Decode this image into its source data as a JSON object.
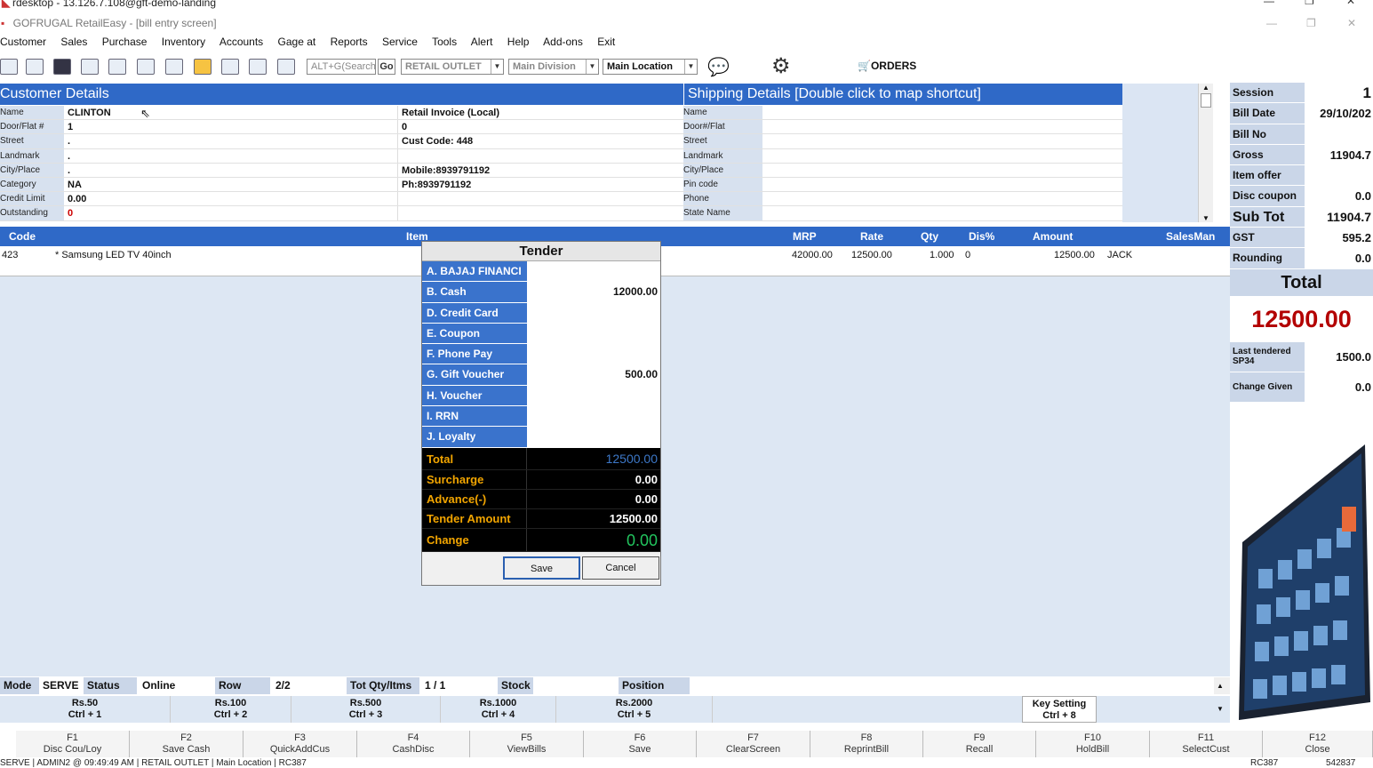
{
  "window": {
    "rd_title": "rdesktop - 13.126.7.108@gft-demo-landing",
    "app_title": "GOFRUGAL RetailEasy - [bill entry screen]"
  },
  "menu": [
    "Customer",
    "Sales",
    "Purchase",
    "Inventory",
    "Accounts",
    "Gage at",
    "Reports",
    "Service",
    "Tools",
    "Alert",
    "Help",
    "Add-ons",
    "Exit"
  ],
  "toolbar": {
    "search_placeholder": "ALT+G(Search",
    "go": "Go",
    "outlet": "RETAIL OUTLET",
    "division": "Main Division",
    "location": "Main Location",
    "orders": "ORDERS"
  },
  "customer": {
    "title": "Customer Details",
    "rows": [
      {
        "label": "Name",
        "v1": "CLINTON",
        "v2": "Retail Invoice (Local)"
      },
      {
        "label": "Door/Flat #",
        "v1": "1",
        "v2": "0"
      },
      {
        "label": "Street",
        "v1": ".",
        "v2": "Cust Code: 448"
      },
      {
        "label": "Landmark",
        "v1": ".",
        "v2": ""
      },
      {
        "label": "City/Place",
        "v1": ".",
        "v2": "Mobile:8939791192"
      },
      {
        "label": "Category",
        "v1": "NA",
        "v2": "Ph:8939791192"
      },
      {
        "label": "Credit Limit",
        "v1": "0.00",
        "v2": ""
      },
      {
        "label": "Outstanding",
        "v1": "0",
        "v2": ""
      }
    ]
  },
  "shipping": {
    "title": "Shipping Details  [Double click to map shortcut]",
    "labels": [
      "Name",
      "Door#/Flat",
      "Street",
      "Landmark",
      "City/Place",
      "Pin code",
      "Phone",
      "State Name"
    ]
  },
  "summary": {
    "rows": [
      {
        "k": "Session",
        "v": "1"
      },
      {
        "k": "Bill Date",
        "v": "29/10/202"
      },
      {
        "k": "Bill No",
        "v": ""
      },
      {
        "k": "Gross",
        "v": "11904.7"
      },
      {
        "k": "Item offer",
        "v": ""
      },
      {
        "k": "Disc coupon",
        "v": "0.0"
      },
      {
        "k": "Sub Tot",
        "v": "11904.7"
      },
      {
        "k": "GST",
        "v": "595.2"
      },
      {
        "k": "Rounding",
        "v": "0.0"
      }
    ],
    "total_label": "Total",
    "total_value": "12500.00",
    "last_tendered_label": "Last tendered SP34",
    "last_tendered_value": "1500.0",
    "change_given_label": "Change Given",
    "change_given_value": "0.0"
  },
  "grid": {
    "headers": [
      "Code",
      "Item",
      "MRP",
      "Rate",
      "Qty",
      "Dis%",
      "Amount",
      "SalesMan"
    ],
    "row": {
      "code": "423",
      "item": "* Samsung LED TV 40inch",
      "mrp": "42000.00",
      "rate": "12500.00",
      "qty": "1.000",
      "dis": "0",
      "amount": "12500.00",
      "salesman": "JACK"
    }
  },
  "tender": {
    "title": "Tender",
    "rows": [
      {
        "k": "A. BAJAJ FINANCI",
        "v": ""
      },
      {
        "k": "B. Cash",
        "v": "12000.00"
      },
      {
        "k": "D. Credit Card",
        "v": ""
      },
      {
        "k": "E. Coupon",
        "v": ""
      },
      {
        "k": "F. Phone Pay",
        "v": ""
      },
      {
        "k": "G. Gift Voucher",
        "v": "500.00"
      },
      {
        "k": "H. Voucher",
        "v": ""
      },
      {
        "k": "I. RRN",
        "v": ""
      },
      {
        "k": "J. Loyalty",
        "v": ""
      }
    ],
    "totals": [
      {
        "k": "Total",
        "v": "12500.00"
      },
      {
        "k": "Surcharge",
        "v": "0.00"
      },
      {
        "k": "Advance(-)",
        "v": "0.00"
      },
      {
        "k": "Tender Amount",
        "v": "12500.00"
      },
      {
        "k": "Change",
        "v": "0.00"
      }
    ],
    "save": "Save",
    "cancel": "Cancel"
  },
  "status": {
    "mode_label": "Mode",
    "mode": "SERVE",
    "status_label": "Status",
    "status": "Online",
    "row_label": "Row",
    "row": "2/2",
    "totqty_label": "Tot Qty/Itms",
    "totqty": "1 / 1",
    "stock_label": "Stock",
    "position_label": "Position"
  },
  "denoms": [
    {
      "l1": "Rs.50",
      "l2": "Ctrl + 1"
    },
    {
      "l1": "Rs.100",
      "l2": "Ctrl + 2"
    },
    {
      "l1": "Rs.500",
      "l2": "Ctrl + 3"
    },
    {
      "l1": "Rs.1000",
      "l2": "Ctrl + 4"
    },
    {
      "l1": "Rs.2000",
      "l2": "Ctrl + 5"
    },
    {
      "l1": "Key Setting",
      "l2": "Ctrl + 8"
    }
  ],
  "fkeys": [
    {
      "k": "F1",
      "l": "Disc Cou/Loy"
    },
    {
      "k": "F2",
      "l": "Save Cash"
    },
    {
      "k": "F3",
      "l": "QuickAddCus"
    },
    {
      "k": "F4",
      "l": "CashDisc"
    },
    {
      "k": "F5",
      "l": "ViewBills"
    },
    {
      "k": "F6",
      "l": "Save"
    },
    {
      "k": "F7",
      "l": "ClearScreen"
    },
    {
      "k": "F8",
      "l": "ReprintBill"
    },
    {
      "k": "F9",
      "l": "Recall"
    },
    {
      "k": "F10",
      "l": "HoldBill"
    },
    {
      "k": "F11",
      "l": "SelectCust"
    },
    {
      "k": "F12",
      "l": "Close"
    }
  ],
  "statusline": {
    "left": "SERVE | ADMIN2 @ 09:49:49 AM | RETAIL OUTLET | Main Location | RC387",
    "r1": "RC387",
    "r2": "542837"
  },
  "colors": {
    "header_blue": "#2f69c7",
    "tender_key_blue": "#3a73cc",
    "total_red": "#b30000",
    "change_green": "#22c55e",
    "label_orange": "#f2a500"
  }
}
